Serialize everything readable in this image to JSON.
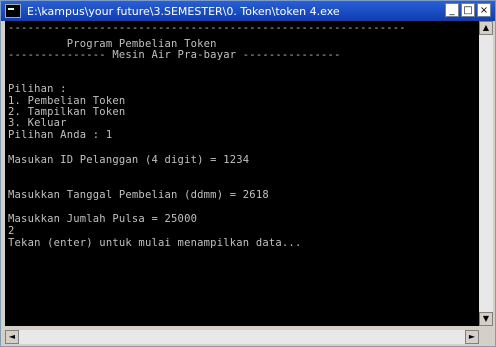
{
  "window": {
    "title": "E:\\kampus\\your future\\3.SEMESTER\\0. Token\\token 4.exe",
    "controls": {
      "minimize": "_",
      "maximize": "□",
      "close": "×"
    }
  },
  "console": {
    "lines": [
      "-------------------------------------------------------------",
      "         Program Pembelian Token",
      "--------------- Mesin Air Pra-bayar ---------------",
      "",
      "Pilihan :",
      "1. Pembelian Token",
      "2. Tampilkan Token",
      "3. Keluar",
      "Pilihan Anda : 1",
      "",
      "Masukan ID Pelanggan (4 digit) = 1234",
      "",
      "Masukkan Tanggal Pembelian (ddmm) = 2618",
      "",
      "Masukkan Jumlah Pulsa = 25000",
      "2",
      "Tekan (enter) untuk mulai menampilkan data..."
    ]
  },
  "scrollbar": {
    "up": "▲",
    "down": "▼",
    "left": "◄",
    "right": "►"
  }
}
